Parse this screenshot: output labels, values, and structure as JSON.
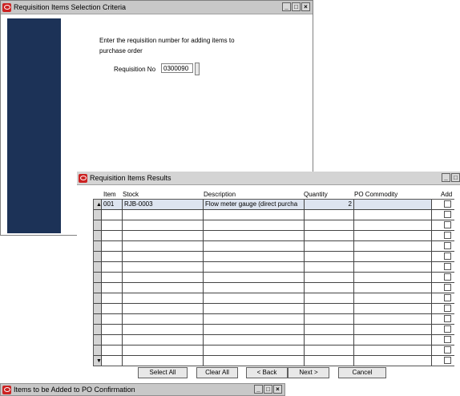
{
  "window1": {
    "title": "Requisition Items Selection Criteria",
    "instruction_line1": "Enter the requisition number for adding items to",
    "instruction_line2": "purchase order",
    "requisition_label": "Requisition No",
    "requisition_value": "0300090"
  },
  "window2": {
    "title": "Requisition Items Results",
    "columns": {
      "item": "Item",
      "stock": "Stock",
      "description": "Description",
      "quantity": "Quantity",
      "po_commodity": "PO Commodity",
      "add": "Add"
    },
    "rows": [
      {
        "item": "001",
        "stock": "RJB-0003",
        "description": "Flow meter gauge (direct purcha",
        "quantity": "2",
        "po_commodity": ""
      },
      {
        "item": "",
        "stock": "",
        "description": "",
        "quantity": "",
        "po_commodity": ""
      },
      {
        "item": "",
        "stock": "",
        "description": "",
        "quantity": "",
        "po_commodity": ""
      },
      {
        "item": "",
        "stock": "",
        "description": "",
        "quantity": "",
        "po_commodity": ""
      },
      {
        "item": "",
        "stock": "",
        "description": "",
        "quantity": "",
        "po_commodity": ""
      },
      {
        "item": "",
        "stock": "",
        "description": "",
        "quantity": "",
        "po_commodity": ""
      },
      {
        "item": "",
        "stock": "",
        "description": "",
        "quantity": "",
        "po_commodity": ""
      },
      {
        "item": "",
        "stock": "",
        "description": "",
        "quantity": "",
        "po_commodity": ""
      },
      {
        "item": "",
        "stock": "",
        "description": "",
        "quantity": "",
        "po_commodity": ""
      },
      {
        "item": "",
        "stock": "",
        "description": "",
        "quantity": "",
        "po_commodity": ""
      },
      {
        "item": "",
        "stock": "",
        "description": "",
        "quantity": "",
        "po_commodity": ""
      },
      {
        "item": "",
        "stock": "",
        "description": "",
        "quantity": "",
        "po_commodity": ""
      },
      {
        "item": "",
        "stock": "",
        "description": "",
        "quantity": "",
        "po_commodity": ""
      },
      {
        "item": "",
        "stock": "",
        "description": "",
        "quantity": "",
        "po_commodity": ""
      },
      {
        "item": "",
        "stock": "",
        "description": "",
        "quantity": "",
        "po_commodity": ""
      },
      {
        "item": "",
        "stock": "",
        "description": "",
        "quantity": "",
        "po_commodity": ""
      }
    ],
    "buttons": {
      "select_all": "Select All",
      "clear_all": "Clear All",
      "back": "< Back",
      "next": "Next >",
      "cancel": "Cancel"
    }
  },
  "window3": {
    "title": "Items to be Added to PO Confirmation"
  },
  "icons": {
    "app": "oracle-app-icon",
    "scroll_up": "scroll-up-arrow-icon",
    "scroll_down": "scroll-down-arrow-icon"
  },
  "colors": {
    "navy_panel": "#1c3257",
    "app_icon": "#cc2222"
  }
}
